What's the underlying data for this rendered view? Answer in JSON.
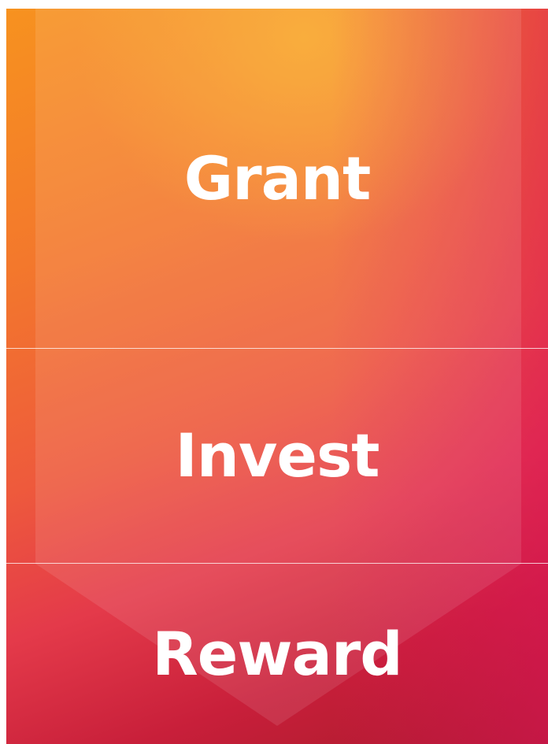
{
  "stages": [
    {
      "label": "Grant"
    },
    {
      "label": "Invest"
    },
    {
      "label": "Reward"
    }
  ],
  "colors": {
    "orange": "#f7921f",
    "coral": "#ee5a3c",
    "crimson": "#c81f3a",
    "magenta": "#d81b60",
    "text": "#ffffff"
  }
}
